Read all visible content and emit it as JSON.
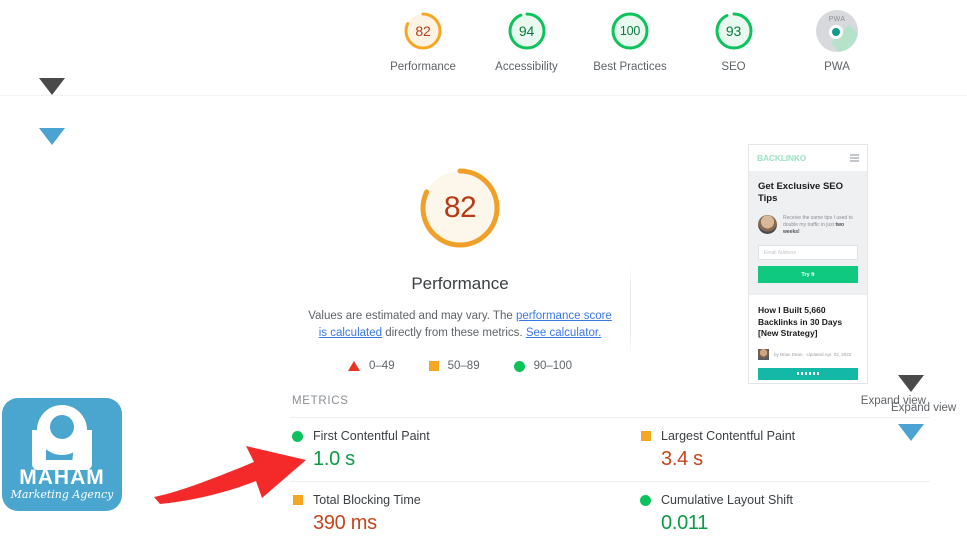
{
  "category_scores": {
    "items": [
      {
        "label": "Performance",
        "value": "82",
        "pct": 82,
        "color": "#f5a623",
        "track": "#fdf3e3",
        "text_color": "#b33d16"
      },
      {
        "label": "Accessibility",
        "value": "94",
        "pct": 94,
        "color": "#0cc35b",
        "track": "#e9f9ef",
        "text_color": "#0b7a3f"
      },
      {
        "label": "Best Practices",
        "value": "100",
        "pct": 100,
        "color": "#0cc35b",
        "track": "#e9f9ef",
        "text_color": "#0b7a3f"
      },
      {
        "label": "SEO",
        "value": "93",
        "pct": 93,
        "color": "#0cc35b",
        "track": "#e9f9ef",
        "text_color": "#0b7a3f"
      }
    ],
    "pwa": {
      "label": "PWA",
      "badge_text": "PWA"
    }
  },
  "performance": {
    "score": "82",
    "title": "Performance",
    "note_part1": "Values are estimated and may vary. The ",
    "note_link1": "performance score is calculated",
    "note_part2": " directly from these metrics. ",
    "note_link2": "See calculator.",
    "legend": [
      {
        "shape": "triangle",
        "range": "0–49"
      },
      {
        "shape": "square",
        "range": "50–89"
      },
      {
        "shape": "circle",
        "range": "90–100"
      }
    ]
  },
  "preview": {
    "logo": "BACKLINK",
    "logo_accent": "O",
    "headline": "Get Exclusive SEO Tips",
    "blurb_plain": "Receive the same tips I used to double my traffic in just ",
    "blurb_bold": "two weeks!",
    "email_placeholder": "Email Address",
    "cta": "Try It",
    "article_title": "How I Built 5,660 Backlinks in 30 Days [New Strategy]",
    "byline": "by Brian Dean · Updated Apr. 02, 2022"
  },
  "metrics": {
    "title": "METRICS",
    "expand_label": "Expand view",
    "items": [
      {
        "indicator": "circle",
        "name": "First Contentful Paint",
        "value": "1.0 s",
        "value_color": "#0b9b45"
      },
      {
        "indicator": "square",
        "name": "Largest Contentful Paint",
        "value": "3.4 s",
        "value_color": "#c4451f"
      },
      {
        "indicator": "square",
        "name": "Total Blocking Time",
        "value": "390 ms",
        "value_color": "#c4451f"
      },
      {
        "indicator": "circle",
        "name": "Cumulative Layout Shift",
        "value": "0.011",
        "value_color": "#0b9b45"
      }
    ]
  },
  "annotations": {
    "expand_view_right": "Expand view"
  },
  "watermark": {
    "name": "MAHAM",
    "tagline": "Marketing Agency"
  }
}
